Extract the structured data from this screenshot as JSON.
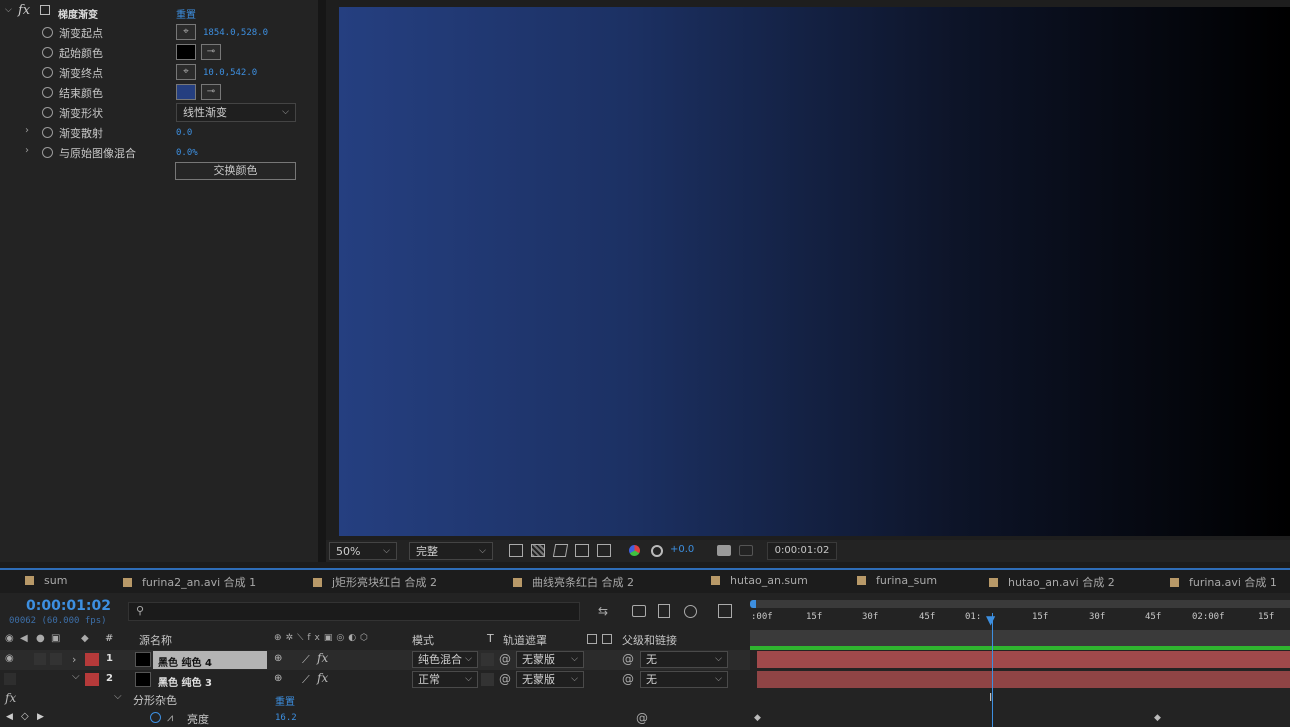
{
  "effect": {
    "title": "梯度渐变",
    "reset": "重置",
    "props": [
      {
        "label": "渐变起点",
        "value": "1854.0,528.0"
      },
      {
        "label": "起始颜色",
        "color": "#000000"
      },
      {
        "label": "渐变终点",
        "value": "10.0,542.0"
      },
      {
        "label": "结束颜色",
        "color": "#253f80"
      },
      {
        "label": "渐变形状",
        "value": "线性渐变"
      },
      {
        "label": "渐变散射",
        "value": "0.0"
      },
      {
        "label": "与原始图像混合",
        "value": "0.0%"
      }
    ],
    "swap_button": "交换颜色"
  },
  "viewer": {
    "zoom": "50%",
    "resolution": "完整",
    "exposure": "+0.0",
    "timecode": "0:00:01:02",
    "gradient": [
      "#253f80",
      "#000000"
    ]
  },
  "tabs": [
    "sum",
    "furina2_an.avi 合成 1",
    "j矩形亮块红白 合成 2",
    "曲线亮条红白 合成 2",
    "hutao_an.sum",
    "furina_sum",
    "hutao_an.avi 合成 2",
    "furina.avi 合成 1"
  ],
  "timeline": {
    "timecode": "0:00:01:02",
    "frames": "00062 (60.000 fps)",
    "columns": {
      "num": "#",
      "source": "源名称",
      "mode": "模式",
      "t": "T",
      "matte": "轨道遮罩",
      "parent": "父级和链接"
    },
    "layers": [
      {
        "num": "1",
        "name": "黑色 纯色 4",
        "mode": "纯色混合",
        "matte": "无蒙版",
        "parent": "无",
        "label_color": "#b53a3a"
      },
      {
        "num": "2",
        "name": "黑色 纯色 3",
        "mode": "正常",
        "matte": "无蒙版",
        "parent": "无",
        "label_color": "#b53a3a"
      }
    ],
    "subeffect": {
      "name": "分形杂色",
      "reset": "重置",
      "prop": "亮度",
      "value": "16.2"
    },
    "ruler": [
      ":00f",
      "15f",
      "30f",
      "45f",
      "01:",
      "15f",
      "30f",
      "45f",
      "02:00f",
      "15f"
    ]
  }
}
